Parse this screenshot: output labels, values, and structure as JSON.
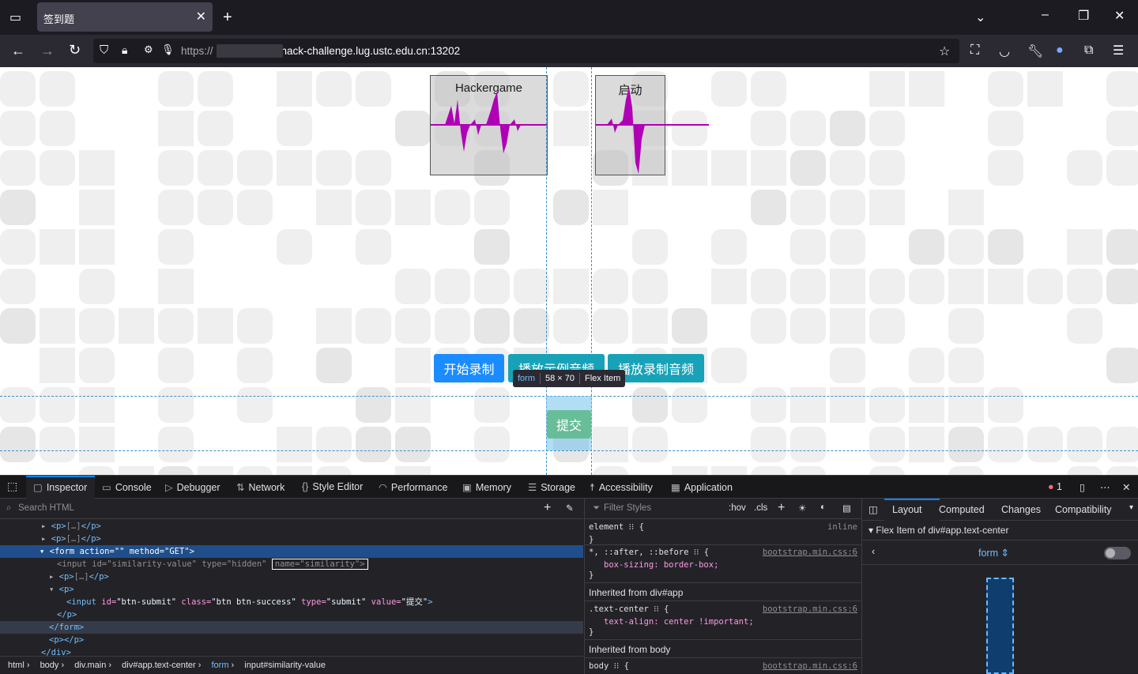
{
  "browser": {
    "tab_title": "签到题",
    "url_prefix": "https://",
    "url_host": "hack-challenge.lug.ustc.edu.cn:13202"
  },
  "page": {
    "wave_labels": [
      "Hackergame",
      "启动"
    ],
    "buttons": [
      "开始录制",
      "播放示例音频",
      "播放录制音频"
    ],
    "submit_label": "提交",
    "wave_color": "#b000b5",
    "primary_color": "#1a8cff",
    "info_color": "#17a2b8",
    "success_color": "#5cb88a"
  },
  "tooltip": {
    "tag": "form",
    "size": "58 × 70",
    "type": "Flex Item"
  },
  "devtools": {
    "tabs": [
      "Inspector",
      "Console",
      "Debugger",
      "Network",
      "Style Editor",
      "Performance",
      "Memory",
      "Storage",
      "Accessibility",
      "Application"
    ],
    "error_count": "1",
    "search_placeholder": "Search HTML",
    "breadcrumbs": [
      "html",
      "body",
      "div.main",
      "div#app.text-center",
      "form",
      "input#similarity-value"
    ],
    "rules": {
      "filter_placeholder": "Filter Styles",
      "hov": ":hov",
      "cls": ".cls",
      "element": "element",
      "inline": "inline",
      "rule2_selector": "*, ::after, ::before",
      "rule2_source": "bootstrap.min.css:6",
      "rule2_decl": "box-sizing: border-box;",
      "inherited1": "Inherited from div#app",
      "rule3_selector": ".text-center",
      "rule3_source": "bootstrap.min.css:6",
      "rule3_decl": "text-align: center !important;",
      "inherited2": "Inherited from body",
      "rule4_selector": "body",
      "rule4_source": "bootstrap.min.css:6"
    },
    "layout": {
      "tabs": [
        "Layout",
        "Computed",
        "Changes",
        "Compatibility"
      ],
      "flex_header": "Flex Item of div#app.text-center",
      "selector": "form"
    }
  }
}
